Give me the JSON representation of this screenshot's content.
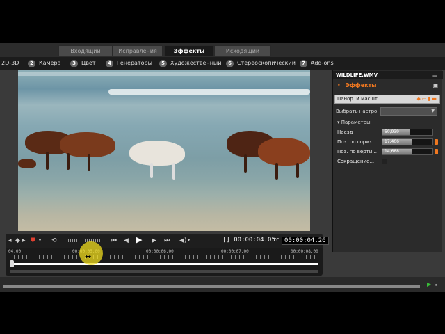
{
  "tabs": [
    {
      "label": "Входящий переход",
      "active": false
    },
    {
      "label": "Исправления",
      "active": false
    },
    {
      "label": "Эффекты",
      "active": true
    },
    {
      "label": "Исходящий переход",
      "active": false
    }
  ],
  "categories": [
    {
      "num": "",
      "label": "2D-3D"
    },
    {
      "num": "2",
      "label": "Камера"
    },
    {
      "num": "3",
      "label": "Цвет"
    },
    {
      "num": "4",
      "label": "Генераторы"
    },
    {
      "num": "5",
      "label": "Художественный"
    },
    {
      "num": "6",
      "label": "Стереоскопический"
    },
    {
      "num": "7",
      "label": "Add-ons"
    }
  ],
  "transport": {
    "timecode_current": "[] 00:00:04.05",
    "tc_label": "TC",
    "timecode_total": "00:00:04.26"
  },
  "timeline": {
    "labels": [
      "04.00",
      "00:00:05.00",
      "00:00:06.00",
      "00:00:07.00",
      "00:00:08.00"
    ]
  },
  "panel": {
    "clip_name": "WILDLIFE.WMV",
    "effects_title": "Эффекты",
    "effect_item": "Панор. и масшт.",
    "preset_label": "Выбрать настро",
    "params_title": "Параметры",
    "params": [
      {
        "label": "Наезд",
        "value": "50,939",
        "fill": 0.55
      },
      {
        "label": "Поз. по гориз...",
        "value": "17,406",
        "fill": 0.6
      },
      {
        "label": "Поз. по верти...",
        "value": "14,688",
        "fill": 0.58
      }
    ],
    "checkbox_label": "Сокращение..."
  },
  "colors": {
    "accent": "#f07820",
    "playhead": "#e03030"
  }
}
